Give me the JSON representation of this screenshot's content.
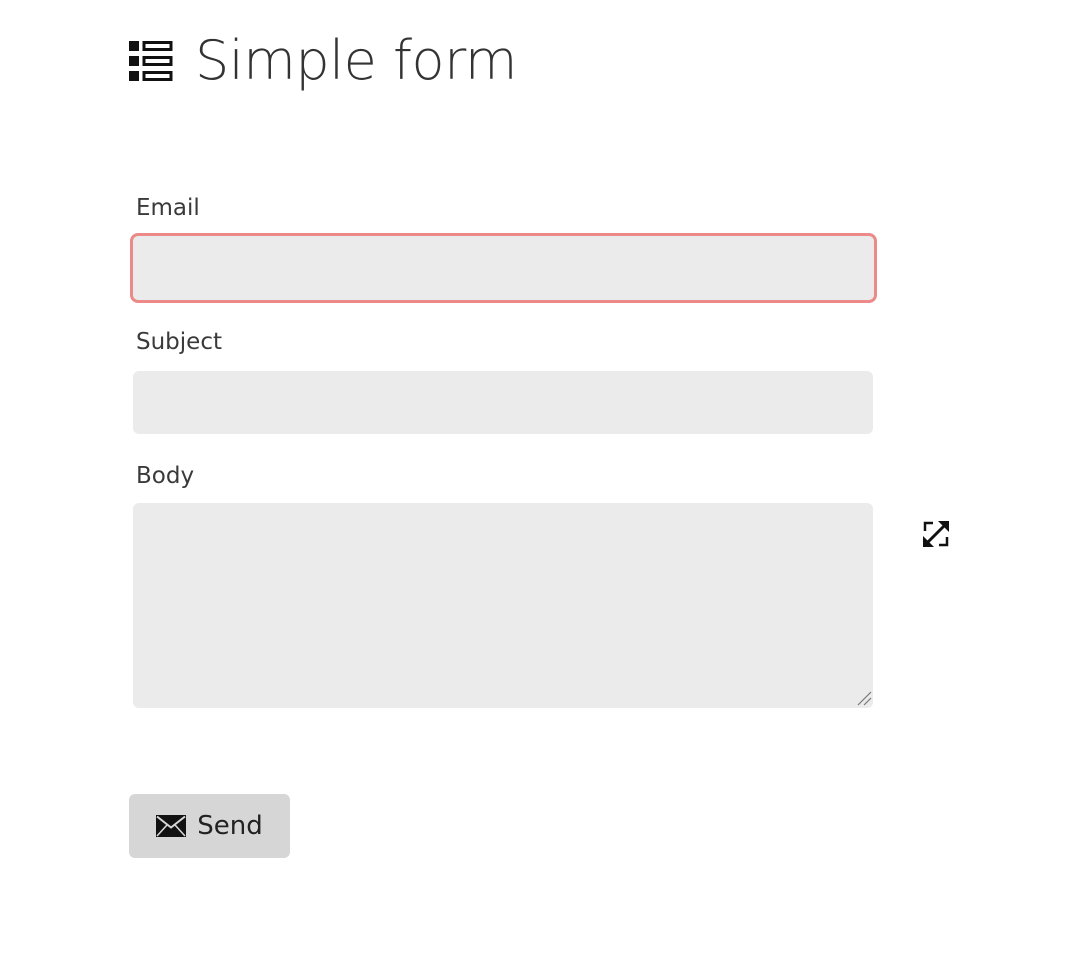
{
  "header": {
    "icon": "form-list-icon",
    "title": "Simple form"
  },
  "form": {
    "email": {
      "label": "Email",
      "value": "",
      "placeholder": "",
      "state": "invalid",
      "border_color": "#ec8a8a"
    },
    "subject": {
      "label": "Subject",
      "value": "",
      "placeholder": ""
    },
    "body": {
      "label": "Body",
      "value": "",
      "placeholder": "",
      "expand_icon": "expand-arrows-icon"
    },
    "send_button": {
      "label": "Send",
      "icon": "envelope-icon"
    }
  },
  "colors": {
    "field_background": "#ebebeb",
    "button_background": "#d6d6d6",
    "invalid_border": "#ec8a8a",
    "text": "#333333"
  }
}
